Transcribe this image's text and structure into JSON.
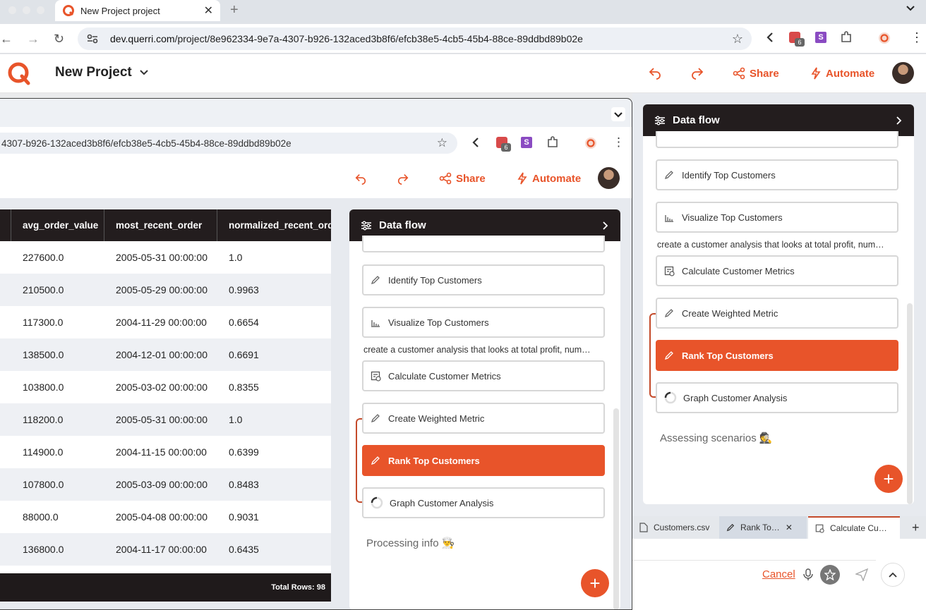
{
  "browser": {
    "tab_title": "New Project project",
    "url_host": "dev.querri.com",
    "url_path": "/project/8e962334-9e7a-4307-b926-132aced3b8f6/efcb38e5-4cb5-45b4-88ce-89ddbd89b02e",
    "ext_badge": "6",
    "ext_s": "S"
  },
  "app": {
    "project_title": "New Project",
    "share_label": "Share",
    "automate_label": "Automate"
  },
  "nested": {
    "url": "4307-b926-132aced3b8f6/efcb38e5-4cb5-45b4-88ce-89ddbd89b02e",
    "ext_badge": "6",
    "ext_s": "S",
    "share_label": "Share",
    "automate_label": "Automate"
  },
  "table": {
    "columns": [
      "avg_order_value",
      "most_recent_order",
      "normalized_recent_ord"
    ],
    "rows": [
      [
        "227600.0",
        "2005-05-31 00:00:00",
        "1.0"
      ],
      [
        "210500.0",
        "2005-05-29 00:00:00",
        "0.9963"
      ],
      [
        "117300.0",
        "2004-11-29 00:00:00",
        "0.6654"
      ],
      [
        "138500.0",
        "2004-12-01 00:00:00",
        "0.6691"
      ],
      [
        "103800.0",
        "2005-03-02 00:00:00",
        "0.8355"
      ],
      [
        "118200.0",
        "2005-05-31 00:00:00",
        "1.0"
      ],
      [
        "114900.0",
        "2004-11-15 00:00:00",
        "0.6399"
      ],
      [
        "107800.0",
        "2005-03-09 00:00:00",
        "0.8483"
      ],
      [
        "88000.0",
        "2005-04-08 00:00:00",
        "0.9031"
      ],
      [
        "136800.0",
        "2004-11-17 00:00:00",
        "0.6435"
      ]
    ],
    "total_rows": "Total Rows: 98"
  },
  "dataflow_inner": {
    "title": "Data flow",
    "steps": [
      "Identify Top Customers",
      "Visualize Top Customers",
      "Calculate Customer Metrics",
      "Create Weighted Metric",
      "Rank Top Customers",
      "Graph Customer Analysis"
    ],
    "prompt": "create a customer analysis that looks at total profit, num…",
    "status": "Processing info 👨‍🍳"
  },
  "dataflow_outer": {
    "title": "Data flow",
    "steps": [
      "Identify Top Customers",
      "Visualize Top Customers",
      "Calculate Customer Metrics",
      "Create Weighted Metric",
      "Rank Top Customers",
      "Graph Customer Analysis"
    ],
    "prompt": "create a customer analysis that looks at total profit, num…",
    "status": "Assessing scenarios 🕵️"
  },
  "bottom_tabs": [
    "Customers.csv",
    "Rank To…",
    "Calculate Cu…"
  ],
  "chat": {
    "cancel_label": "Cancel"
  },
  "colors": {
    "accent": "#e8542a",
    "dark": "#231d1e"
  }
}
